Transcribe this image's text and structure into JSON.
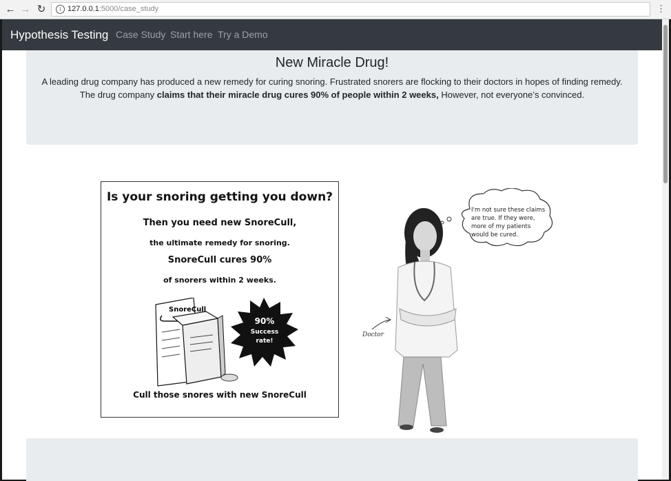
{
  "browser": {
    "url_host": "127.0.0.1",
    "url_port": ":5000",
    "url_path": "/case_study"
  },
  "navbar": {
    "brand": "Hypothesis Testing",
    "links": [
      "Case Study",
      "Start here",
      "Try a Demo"
    ]
  },
  "intro": {
    "title": "New Miracle Drug!",
    "line1": "A leading drug company has produced a new remedy for curing snoring. Frustrated snorers are flocking to their doctors in hopes of finding remedy.",
    "line2_pre": "The drug company ",
    "line2_bold": "claims that their miracle drug cures 90% of people within 2 weeks,",
    "line2_post": " However, not everyone’s convinced."
  },
  "ad": {
    "headline": "Is your snoring getting you down?",
    "line1": "Then you need new SnoreCull,",
    "line2": "the ultimate remedy for snoring.",
    "line3": "SnoreCull cures 90%",
    "line4": "of snorers within 2 weeks.",
    "badge_1": "90%",
    "badge_2": "Success",
    "badge_3": "rate!",
    "box_brand": "SnoreCull",
    "footer": "Cull those snores with new SnoreCull"
  },
  "doctor": {
    "bubble": "I'm not sure these claims are true. If they were, more of my patients would be cured.",
    "label": "Doctor"
  }
}
